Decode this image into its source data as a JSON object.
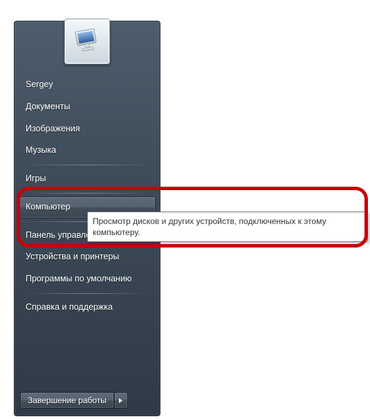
{
  "menu": {
    "user": "Sergey",
    "documents": "Документы",
    "pictures": "Изображения",
    "music": "Музыка",
    "games": "Игры",
    "computer": "Компьютер",
    "control_panel": "Панель управления",
    "devices_printers": "Устройства и принтеры",
    "default_programs": "Программы по умолчанию",
    "help_support": "Справка и поддержка"
  },
  "shutdown": {
    "label": "Завершение работы"
  },
  "tooltip": {
    "text": "Просмотр дисков и других устройств, подключенных к этому компьютеру."
  }
}
